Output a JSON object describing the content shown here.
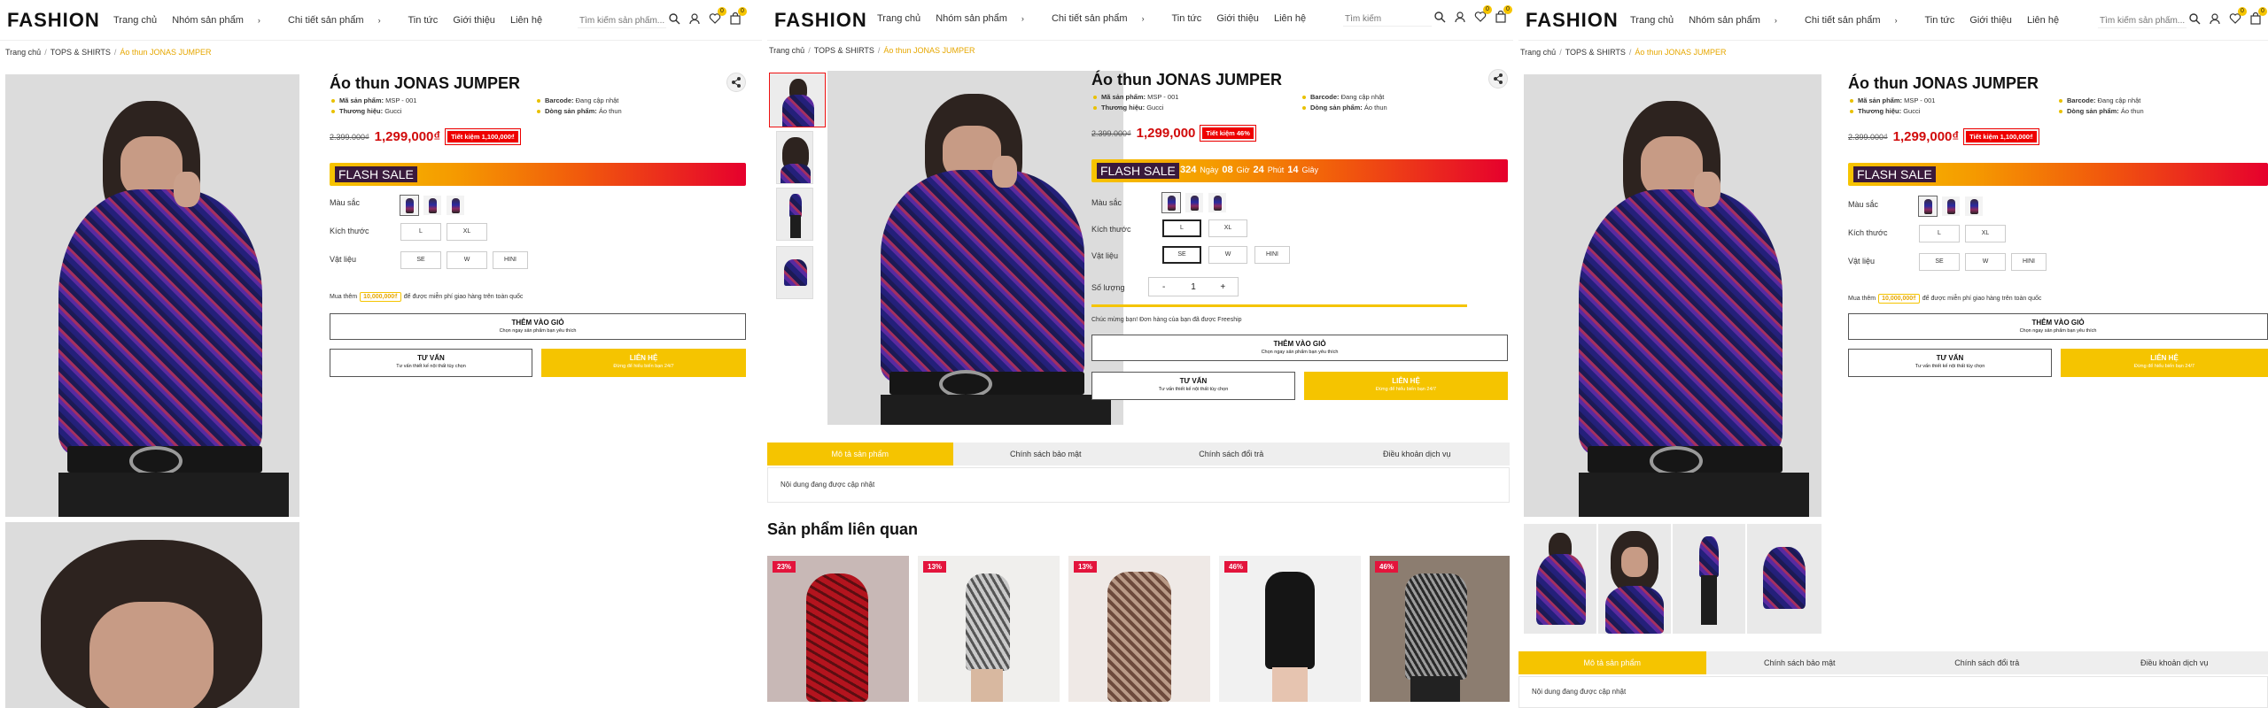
{
  "brand": {
    "logo": "FASHION",
    "accent": "#f5c400",
    "price_color": "#d10b0b"
  },
  "nav": {
    "home": "Trang chủ",
    "groups": "Nhóm sản phẩm",
    "detail": "Chi tiết sản phẩm",
    "news": "Tin tức",
    "about": "Giới thiệu",
    "contact": "Liên hệ"
  },
  "header": {
    "search_placeholder_long": "Tìm kiếm sản phẩm...",
    "search_placeholder_short": "Tìm kiếm",
    "wishlist_count": "0",
    "cart_count": "0"
  },
  "breadcrumb": {
    "home": "Trang chủ",
    "category": "TOPS & SHIRTS",
    "current": "Áo thun JONAS JUMPER"
  },
  "product": {
    "title": "Áo thun JONAS JUMPER",
    "sku_label": "Mã sản phẩm:",
    "sku": "MSP - 001",
    "brand_label": "Thương hiệu:",
    "brand": "Gucci",
    "barcode_label": "Barcode:",
    "barcode": "Đang cập nhật",
    "line_label": "Dòng sản phẩm:",
    "line": "Áo thun",
    "old_price": "2.399.000₫",
    "price": "1,299,000₫",
    "price_alt": "1,299,000",
    "save": "Tiết kiệm 1,100,000₫",
    "save_pct": "Tiết kiệm 46%",
    "flash_sale": "FLASH SALE",
    "countdown": {
      "num1": "324",
      "u1": "Ngày",
      "num2": "08",
      "u2": "Giờ",
      "num3": "24",
      "u3": "Phút",
      "num4": "14",
      "u4": "Giây"
    },
    "color_label": "Màu sắc",
    "size_label": "Kích thước",
    "sizes": [
      "L",
      "XL"
    ],
    "material_label": "Vật liệu",
    "materials": [
      "SE",
      "W",
      "HINI"
    ],
    "qty_label": "Số lượng",
    "qty_minus": "-",
    "qty_value": "1",
    "qty_plus": "+",
    "ship_before": "Mua thêm",
    "ship_amount": "10,000,000₫",
    "ship_after": "để được miễn phí giao hàng trên toàn quốc",
    "freeship_msg": "Chúc mừng bạn! Đơn hàng của bạn đã được Freeship",
    "add_cart": "THÊM VÀO GIỎ",
    "add_cart_sub": "Chọn ngay sản phẩm bạn yêu thích",
    "consult": "TƯ VẤN",
    "consult_sub": "Tư vấn thiết kế nội thất tùy chọn",
    "contact": "LIÊN HỆ",
    "contact_sub": "Đừng để hiểu biến bạn 24/7"
  },
  "tabs": {
    "items": [
      "Mô tả sản phẩm",
      "Chính sách bảo mật",
      "Chính sách đổi trả",
      "Điều khoản dịch vụ"
    ],
    "body": "Nội dung đang được cập nhật"
  },
  "related": {
    "heading": "Sản phẩm liên quan",
    "discounts": [
      "23%",
      "13%",
      "13%",
      "46%",
      "46%"
    ]
  }
}
